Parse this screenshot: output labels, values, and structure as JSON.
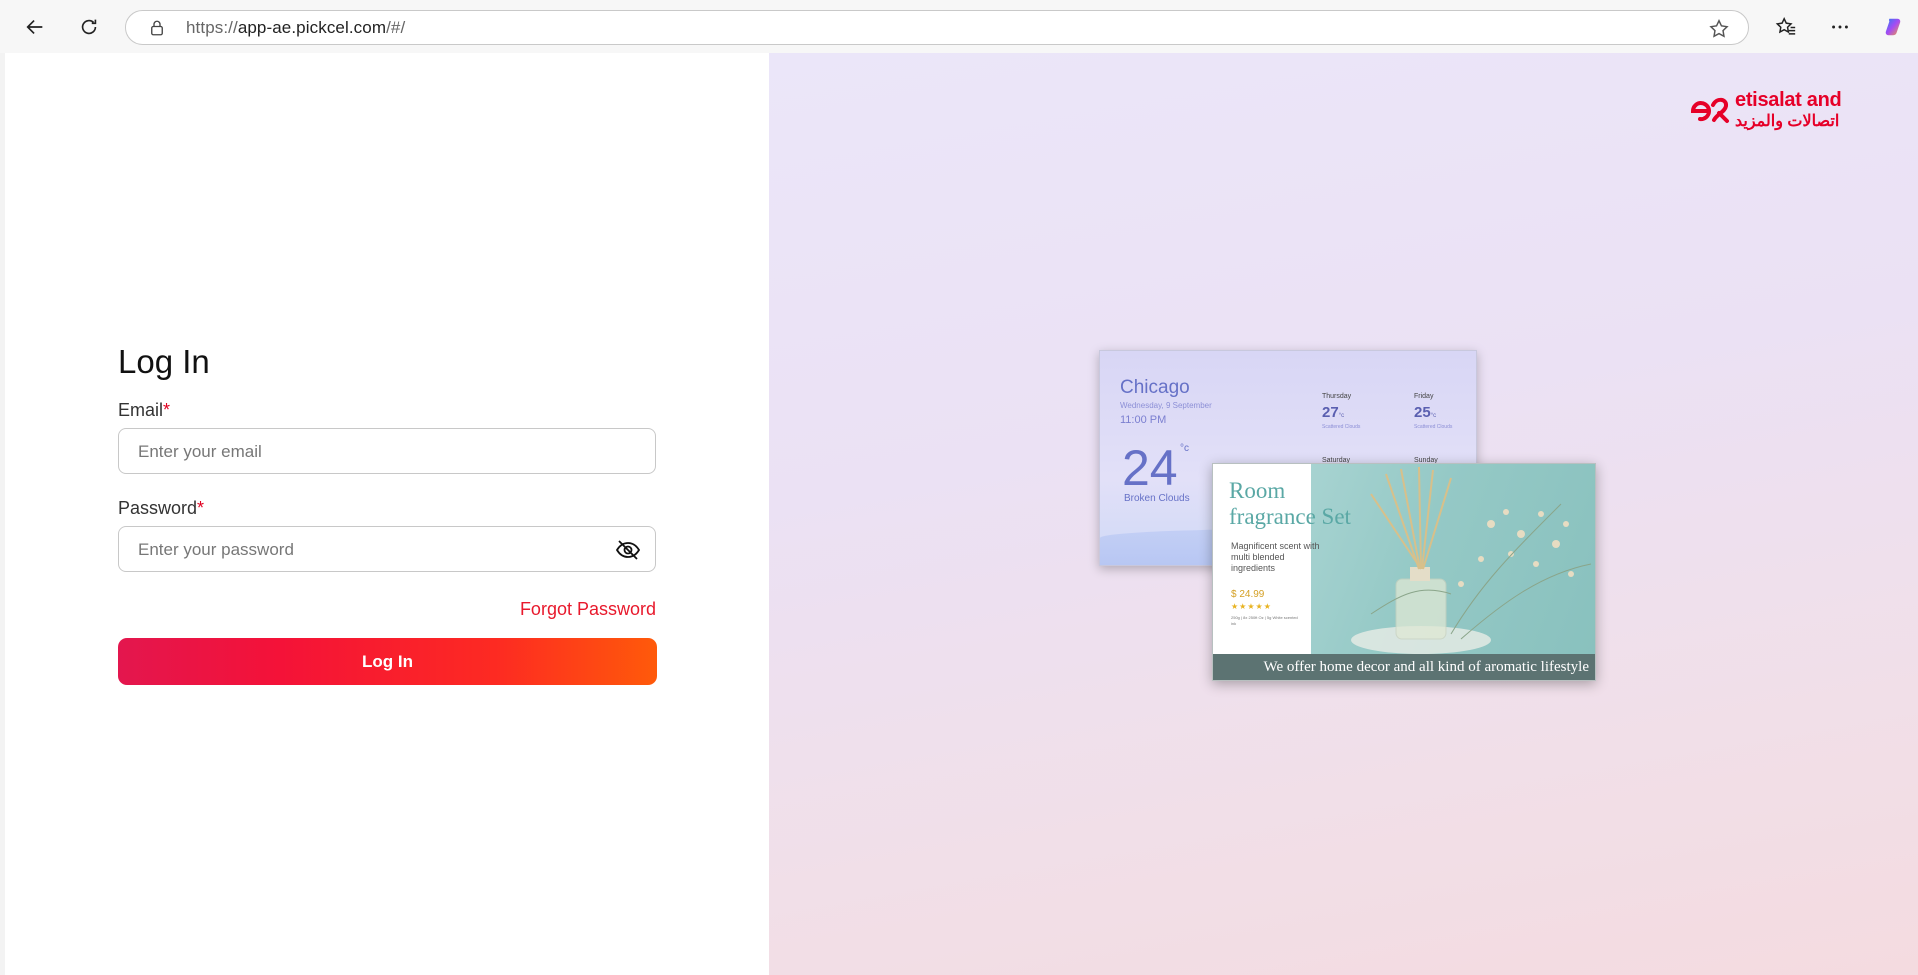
{
  "browser": {
    "url_prefix": "https://",
    "url_host": "app-ae.pickcel.com",
    "url_path": "/#/"
  },
  "login": {
    "title": "Log In",
    "email_label": "Email",
    "email_placeholder": "Enter your email",
    "password_label": "Password",
    "password_placeholder": "Enter your password",
    "required_mark": "*",
    "forgot_label": "Forgot Password",
    "submit_label": "Log In"
  },
  "brand": {
    "name_en": "etisalat and",
    "name_ar": "اتصالات والمزيد",
    "color": "#e60028"
  },
  "weather_card": {
    "city": "Chicago",
    "date": "Wednesday, 9 September",
    "time": "11:00 PM",
    "temp": "24",
    "unit": "°c",
    "condition": "Broken Clouds",
    "forecast": [
      {
        "day": "Thursday",
        "temp": "27",
        "unit": "°c",
        "condition": "Scattered Clouds"
      },
      {
        "day": "Friday",
        "temp": "25",
        "unit": "°c",
        "condition": "Scattered Clouds"
      },
      {
        "day": "Saturday"
      },
      {
        "day": "Sunday"
      }
    ]
  },
  "fragrance_card": {
    "title_line1": "Room",
    "title_line2": "fragrance Set",
    "description": "Magnificent scent with multi blended ingredients",
    "price": "$ 24.99",
    "stars": "★★★★★",
    "fine_print": "250g | 8x 250ft Oz | 5g White scented ink",
    "tagline": "We offer home decor and all kind of aromatic lifestyle"
  },
  "colors": {
    "accent": "#e8192c",
    "button_start": "#e3164e",
    "button_end": "#ff5a0a"
  }
}
